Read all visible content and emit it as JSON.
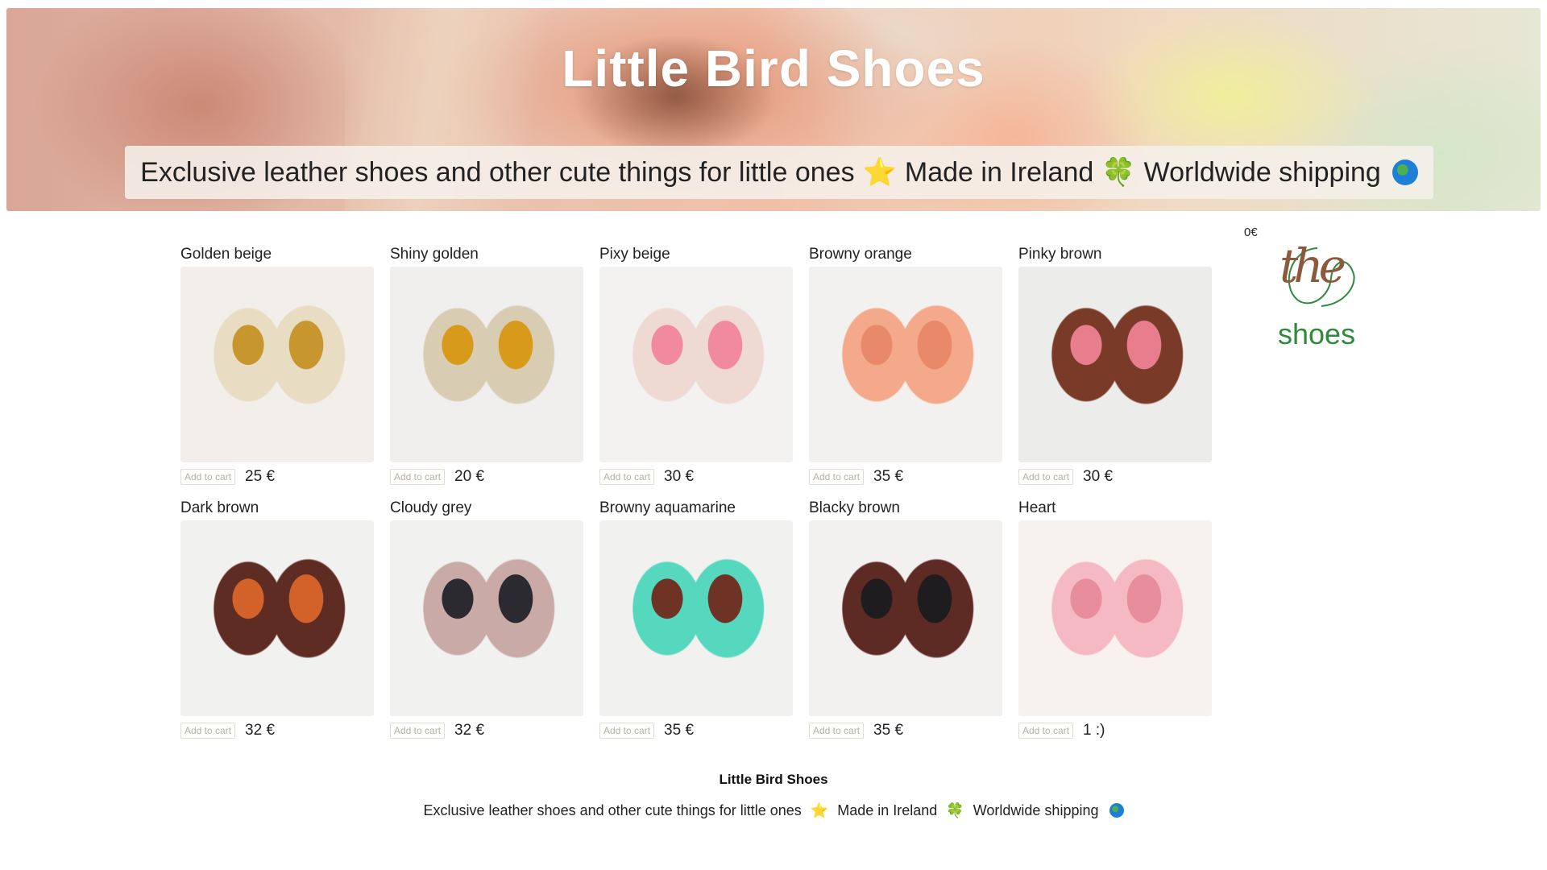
{
  "header": {
    "title": "Little Bird Shoes",
    "tagline_part1": "Exclusive leather shoes and other cute things for little ones",
    "star": "⭐",
    "tagline_part2": "Made in Ireland",
    "clover": "🍀",
    "tagline_part3": "Worldwide shipping"
  },
  "cart": {
    "total": "0€"
  },
  "logo": {
    "top": "the",
    "bottom": "shoes"
  },
  "add_to_cart_label": "Add to cart",
  "products": [
    {
      "name": "Golden beige",
      "price": "25 €",
      "colors": [
        "#f2efeb",
        "#e8dcc3",
        "#c8962e"
      ]
    },
    {
      "name": "Shiny golden",
      "price": "20 €",
      "colors": [
        "#f0efed",
        "#d8cdb3",
        "#d89a1a"
      ]
    },
    {
      "name": "Pixy beige",
      "price": "30 €",
      "colors": [
        "#f3f2f1",
        "#efd9d3",
        "#f08a9c"
      ]
    },
    {
      "name": "Browny orange",
      "price": "35 €",
      "colors": [
        "#f3f1ef",
        "#f4a98a",
        "#e8896a"
      ]
    },
    {
      "name": "Pinky brown",
      "price": "30 €",
      "colors": [
        "#ececeb",
        "#7a3a28",
        "#e77d8d"
      ]
    },
    {
      "name": "Dark brown",
      "price": "32 €",
      "colors": [
        "#f1f1f0",
        "#5e2c22",
        "#d2622a"
      ]
    },
    {
      "name": "Cloudy grey",
      "price": "32 €",
      "colors": [
        "#f1f1f0",
        "#c9aaa6",
        "#2a2a30"
      ]
    },
    {
      "name": "Browny aquamarine",
      "price": "35 €",
      "colors": [
        "#f1f1f0",
        "#55d8bd",
        "#6e3324"
      ]
    },
    {
      "name": "Blacky brown",
      "price": "35 €",
      "colors": [
        "#f2f1f0",
        "#5e2a24",
        "#1f1c20"
      ]
    },
    {
      "name": "Heart",
      "price": "1 :)",
      "colors": [
        "#f7f2ee",
        "#f4b9c2",
        "#e88d9b"
      ]
    }
  ],
  "footer": {
    "title": "Little Bird Shoes",
    "tagline_part1": "Exclusive leather shoes and other cute things for little ones",
    "star": "⭐",
    "tagline_part2": "Made in Ireland",
    "clover": "🍀",
    "tagline_part3": "Worldwide shipping"
  }
}
